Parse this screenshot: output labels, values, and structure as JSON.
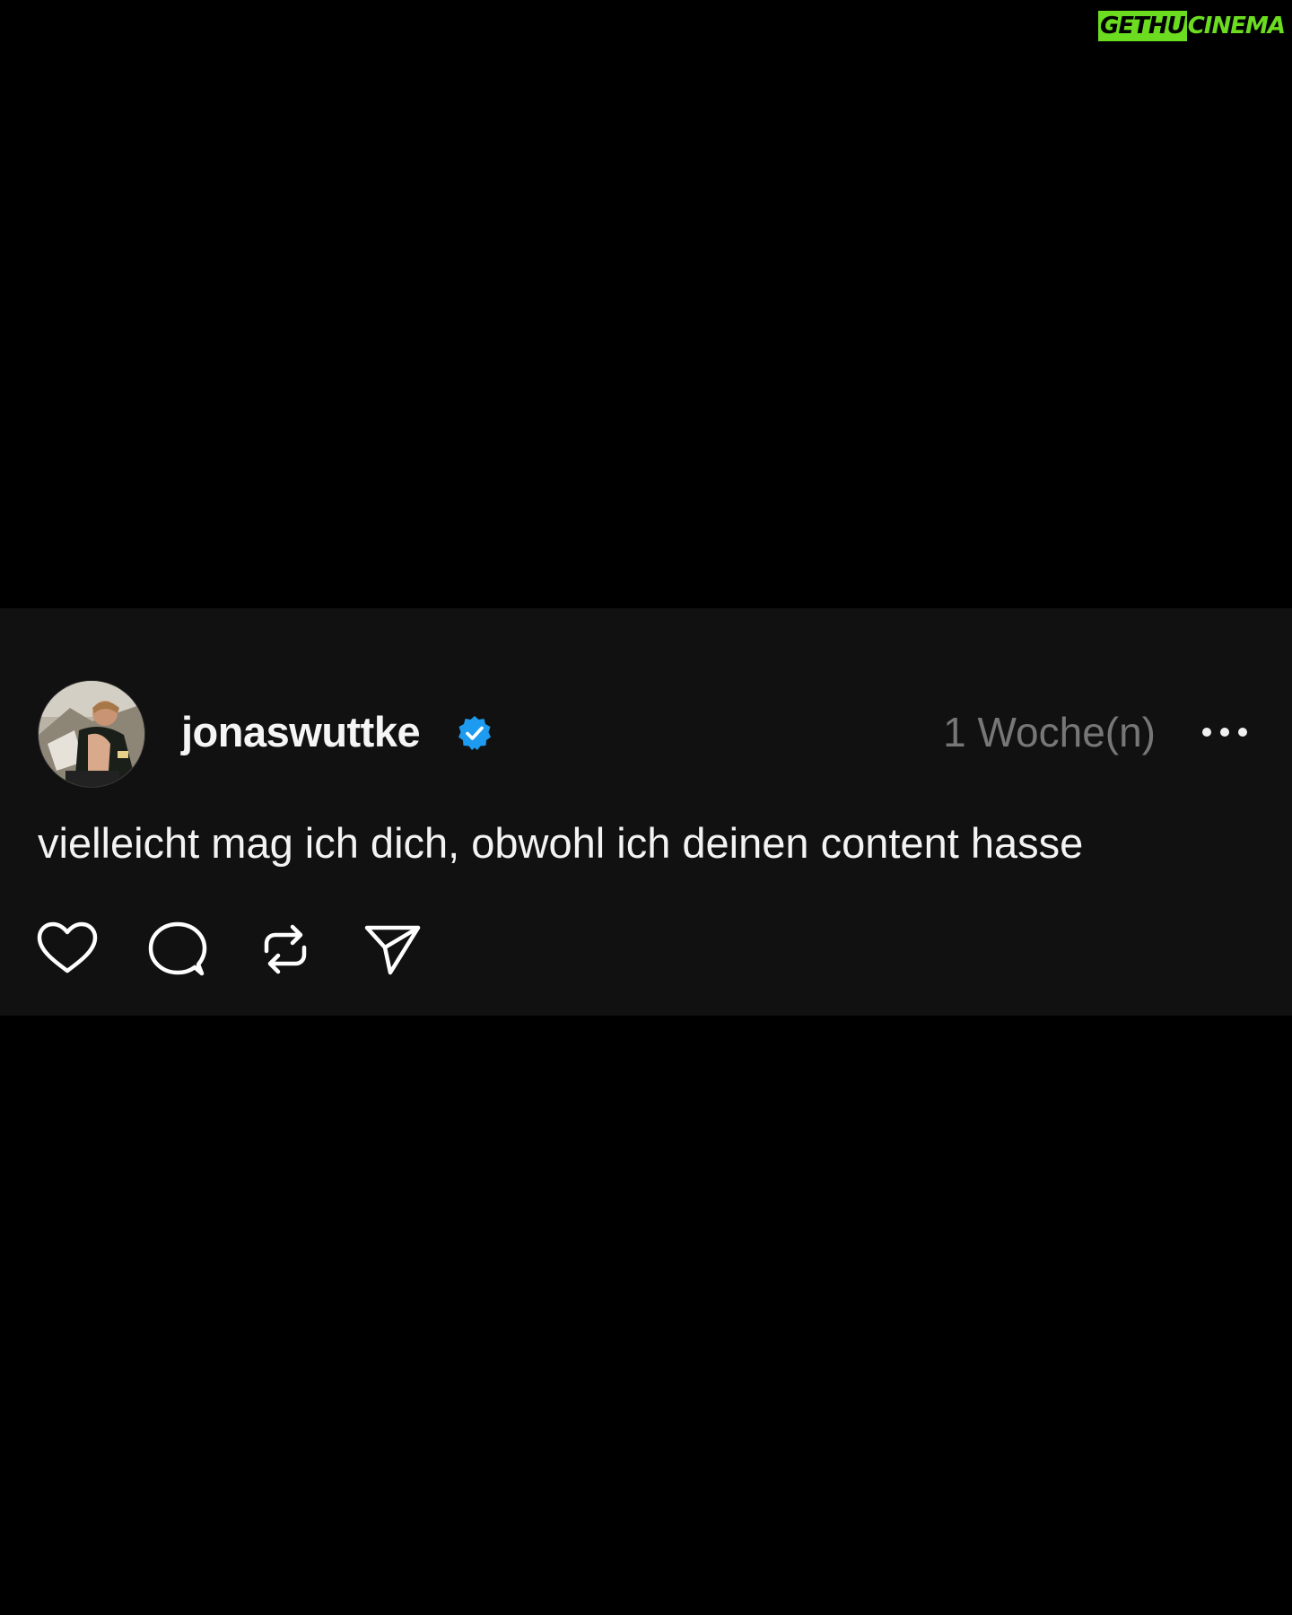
{
  "watermark": {
    "part1": "GETHU",
    "part2": "CINEMA"
  },
  "post": {
    "username": "jonaswuttke",
    "verified": true,
    "timestamp": "1 Woche(n)",
    "text": "vielleicht mag ich dich, obwohl ich deinen content hasse"
  },
  "actions": [
    {
      "icon": "heart-icon"
    },
    {
      "icon": "comment-icon"
    },
    {
      "icon": "repost-icon"
    },
    {
      "icon": "share-icon"
    }
  ],
  "colors": {
    "background": "#000000",
    "card": "#111111",
    "verified": "#1d9bf0",
    "watermark": "#6bdc1f",
    "timestamp": "#777777"
  }
}
